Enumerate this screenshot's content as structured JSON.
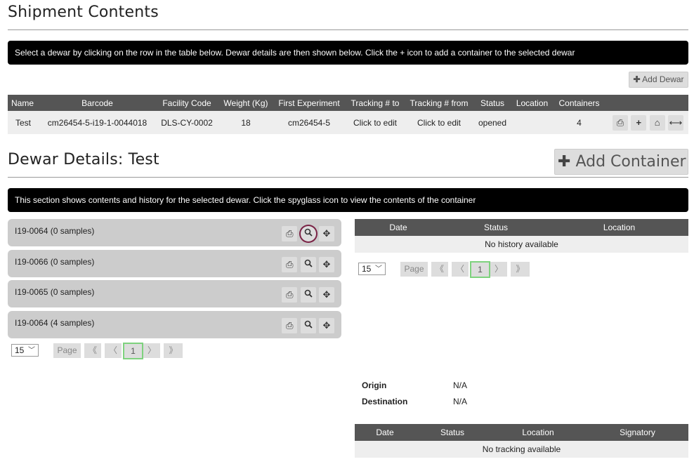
{
  "shipment": {
    "title": "Shipment Contents",
    "info": "Select a dewar by clicking on the row in the table below. Dewar details are then shown below. Click the + icon to add a container to the selected dewar",
    "add_dewar_label": "Add Dewar",
    "columns": [
      "Name",
      "Barcode",
      "Facility Code",
      "Weight (Kg)",
      "First Experiment",
      "Tracking # to",
      "Tracking # from",
      "Status",
      "Location",
      "Containers"
    ],
    "row": {
      "name": "Test",
      "barcode": "cm26454-5-i19-1-0044018",
      "facility_code": "DLS-CY-0002",
      "weight": "18",
      "first_experiment": "cm26454-5",
      "tracking_to": "Click to edit",
      "tracking_from": "Click to edit",
      "status": "opened",
      "location": "",
      "containers": "4"
    }
  },
  "dewar": {
    "title": "Dewar Details: Test",
    "add_container_label": "Add Container",
    "info": "This section shows contents and history for the selected dewar. Click the spyglass icon to view the contents of the container",
    "containers": [
      {
        "label": "I19-0064 (0 samples)"
      },
      {
        "label": "I19-0066 (0 samples)"
      },
      {
        "label": "I19-0065 (0 samples)"
      },
      {
        "label": "I19-0064 (4 samples)"
      }
    ],
    "pager": {
      "per_page": "15",
      "page_label": "Page",
      "current": "1",
      "first": "《",
      "prev": "〈",
      "next": "〉",
      "last": "》"
    }
  },
  "history": {
    "columns": [
      "Date",
      "Status",
      "Location"
    ],
    "empty": "No history available",
    "pager": {
      "per_page": "15",
      "page_label": "Page",
      "current": "1",
      "first": "《",
      "prev": "〈",
      "next": "〉",
      "last": "》"
    }
  },
  "tracking": {
    "origin_label": "Origin",
    "origin_value": "N/A",
    "destination_label": "Destination",
    "destination_value": "N/A",
    "columns": [
      "Date",
      "Status",
      "Location",
      "Signatory"
    ],
    "empty": "No tracking available"
  },
  "icons": {
    "print": "⎙",
    "plus": "+",
    "home": "⌂",
    "resize": "⟷",
    "search": "search-icon",
    "move": "✥"
  },
  "colors": {
    "header_bg": "#555555",
    "row_bg": "#eeeeee",
    "highlight": "#7a2245",
    "current_page": "#7ed27e"
  }
}
